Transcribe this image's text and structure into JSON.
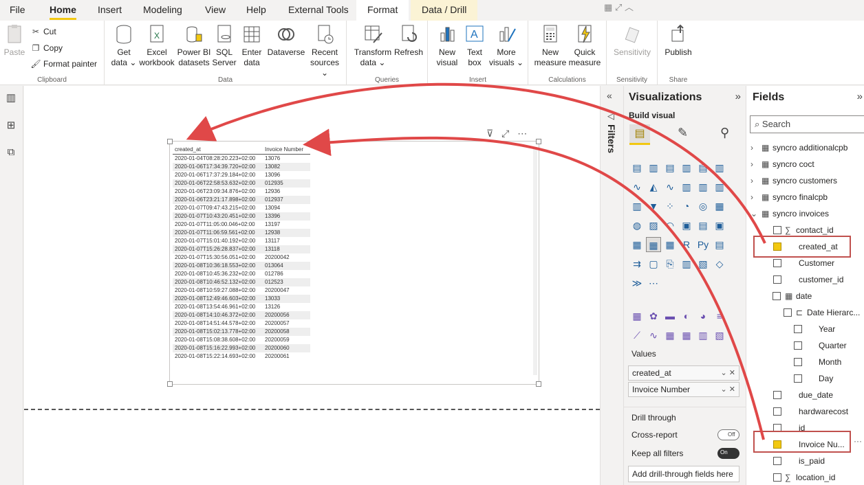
{
  "menu": {
    "tabs": [
      "File",
      "Home",
      "Insert",
      "Modeling",
      "View",
      "Help",
      "External Tools"
    ],
    "context_tabs": [
      "Format",
      "Data / Drill"
    ]
  },
  "ribbon": {
    "clipboard": {
      "paste": "Paste",
      "cut": "Cut",
      "copy": "Copy",
      "format_painter": "Format painter",
      "label": "Clipboard"
    },
    "data": {
      "label": "Data",
      "buttons": [
        {
          "line1": "Get",
          "line2": "data ⌄"
        },
        {
          "line1": "Excel",
          "line2": "workbook"
        },
        {
          "line1": "Power BI",
          "line2": "datasets"
        },
        {
          "line1": "SQL",
          "line2": "Server"
        },
        {
          "line1": "Enter",
          "line2": "data"
        },
        {
          "line1": "Dataverse",
          "line2": ""
        },
        {
          "line1": "Recent",
          "line2": "sources ⌄"
        }
      ]
    },
    "queries": {
      "label": "Queries",
      "buttons": [
        {
          "line1": "Transform",
          "line2": "data ⌄"
        },
        {
          "line1": "Refresh",
          "line2": ""
        }
      ]
    },
    "insert": {
      "label": "Insert",
      "buttons": [
        {
          "line1": "New",
          "line2": "visual"
        },
        {
          "line1": "Text",
          "line2": "box"
        },
        {
          "line1": "More",
          "line2": "visuals ⌄"
        }
      ]
    },
    "calculations": {
      "label": "Calculations",
      "buttons": [
        {
          "line1": "New",
          "line2": "measure"
        },
        {
          "line1": "Quick",
          "line2": "measure"
        }
      ]
    },
    "sensitivity": {
      "label": "Sensitivity",
      "buttons": [
        {
          "line1": "Sensitivity",
          "line2": ""
        }
      ]
    },
    "share": {
      "label": "Share",
      "buttons": [
        {
          "line1": "Publish",
          "line2": ""
        }
      ]
    }
  },
  "table": {
    "headers": [
      "created_at",
      "Invoice Number"
    ],
    "rows": [
      [
        "2020-01-04T08:28:20.223+02:00",
        "13076"
      ],
      [
        "2020-01-06T17:34:39.720+02:00",
        "13082"
      ],
      [
        "2020-01-06T17:37:29.184+02:00",
        "13096"
      ],
      [
        "2020-01-06T22:58:53.632+02:00",
        "012935"
      ],
      [
        "2020-01-06T23:09:34.876+02:00",
        "12936"
      ],
      [
        "2020-01-06T23:21:17.898+02:00",
        "012937"
      ],
      [
        "2020-01-07T09:47:43.215+02:00",
        "13094"
      ],
      [
        "2020-01-07T10:43:20.451+02:00",
        "13396"
      ],
      [
        "2020-01-07T11:05:00.046+02:00",
        "13197"
      ],
      [
        "2020-01-07T11:06:59.561+02:00",
        "12938"
      ],
      [
        "2020-01-07T15:01:40.192+02:00",
        "13117"
      ],
      [
        "2020-01-07T15:26:28.837+02:00",
        "13118"
      ],
      [
        "2020-01-07T15:30:56.051+02:00",
        "20200042"
      ],
      [
        "2020-01-08T10:36:18.553+02:00",
        "013064"
      ],
      [
        "2020-01-08T10:45:36.232+02:00",
        "012786"
      ],
      [
        "2020-01-08T10:46:52.132+02:00",
        "012523"
      ],
      [
        "2020-01-08T10:59:27.088+02:00",
        "20200047"
      ],
      [
        "2020-01-08T12:49:46.603+02:00",
        "13033"
      ],
      [
        "2020-01-08T13:54:46.961+02:00",
        "13126"
      ],
      [
        "2020-01-08T14:10:46.372+02:00",
        "20200056"
      ],
      [
        "2020-01-08T14:51:44.578+02:00",
        "20200057"
      ],
      [
        "2020-01-08T15:02:13.778+02:00",
        "20200058"
      ],
      [
        "2020-01-08T15:08:38.608+02:00",
        "20200059"
      ],
      [
        "2020-01-08T15:16:22.993+02:00",
        "20200060"
      ],
      [
        "2020-01-08T15:22:14.693+02:00",
        "20200061"
      ]
    ]
  },
  "filters_label": "Filters",
  "visualizations": {
    "title": "Visualizations",
    "build_visual": "Build visual",
    "values_label": "Values",
    "wells": [
      "created_at",
      "Invoice Number"
    ],
    "drill_through": "Drill through",
    "cross_report": "Cross-report",
    "cross_report_state": "Off",
    "keep_filters": "Keep all filters",
    "keep_filters_state": "On",
    "add_drill": "Add drill-through fields here",
    "more": "···"
  },
  "fields": {
    "title": "Fields",
    "search_placeholder": "Search",
    "tables": [
      "syncro additionalcpb",
      "syncro coct",
      "syncro customers",
      "syncro finalcpb",
      "syncro invoices"
    ],
    "invoice_fields": [
      "contact_id",
      "created_at",
      "Customer",
      "customer_id",
      "date",
      "Date Hierarc...",
      "Year",
      "Quarter",
      "Month",
      "Day",
      "due_date",
      "hardwarecost",
      "id",
      "Invoice Nu...",
      "is_paid",
      "location_id"
    ]
  },
  "colors": {
    "accent": "#f2c811",
    "arrow": "#e04848",
    "highlight_box": "#c0504d"
  }
}
